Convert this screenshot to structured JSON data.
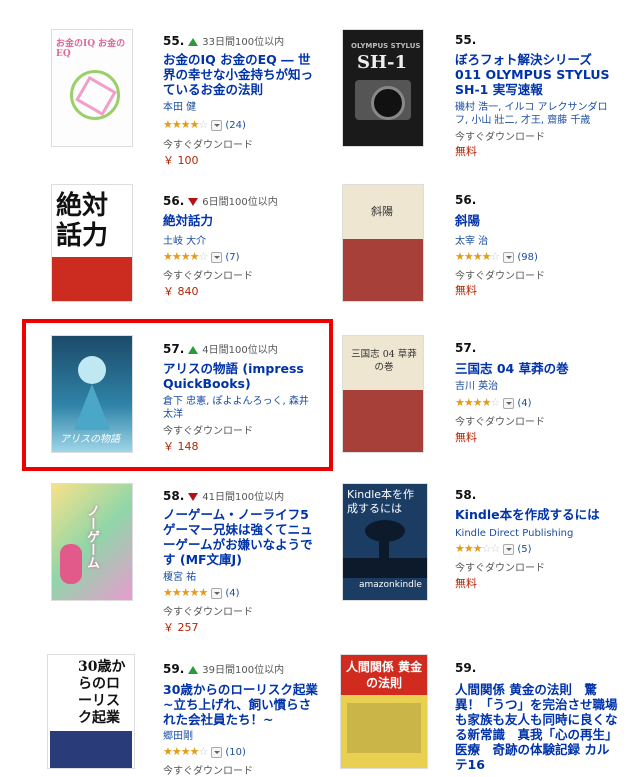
{
  "items": {
    "i55a": {
      "rank": "55.",
      "meta": "33日間100位以内",
      "title": "お金のIQ お金のEQ ― 世界の幸せな小金持ちが知っているお金の法則",
      "author": "本田 健",
      "reviews": "(24)",
      "availability": "今すぐダウンロード",
      "price": "￥ 100",
      "cover_text": "お金のIQ お金のEQ"
    },
    "i55b": {
      "rank": "55.",
      "title": "ぼろフォト解決シリーズ011 OLYMPUS STYLUS SH-1 実写速報",
      "author": "磯村 浩一, イルコ アレクサンダロフ, 小山 壯二, 才王, 齋藤 千歳",
      "availability": "今すぐダウンロード",
      "price": "無料",
      "cover_text": "SH-1"
    },
    "i56a": {
      "rank": "56.",
      "meta": "6日間100位以内",
      "title": "絶対話力",
      "author": "土岐 大介",
      "reviews": "(7)",
      "availability": "今すぐダウンロード",
      "price": "￥ 840",
      "cover_text": "絶対話力"
    },
    "i56b": {
      "rank": "56.",
      "title": "斜陽",
      "author": "太宰 治",
      "reviews": "(98)",
      "availability": "今すぐダウンロード",
      "price": "無料",
      "cover_text": "斜陽"
    },
    "i57a": {
      "rank": "57.",
      "meta": "4日間100位以内",
      "title": "アリスの物語 (impress QuickBooks)",
      "author": "倉下 忠憲, ぽよよんろっく, 森井 太洋",
      "availability": "今すぐダウンロード",
      "price": "￥ 148",
      "cover_text": "アリスの物語"
    },
    "i57b": {
      "rank": "57.",
      "title": "三国志 04 草莽の巻",
      "author": "吉川 英治",
      "reviews": "(4)",
      "availability": "今すぐダウンロード",
      "price": "無料",
      "cover_text": "三国志 04 草莽の巻"
    },
    "i58a": {
      "rank": "58.",
      "meta": "41日間100位以内",
      "title": "ノーゲーム・ノーライフ5 ゲーマー兄妹は強くてニューゲームがお嫌いなようです (MF文庫J)",
      "author": "榎宮 祐",
      "reviews": "(4)",
      "availability": "今すぐダウンロード",
      "price": "￥ 257",
      "cover_text": "ノーゲーム"
    },
    "i58b": {
      "rank": "58.",
      "title": "Kindle本を作成するには",
      "author": "Kindle Direct Publishing",
      "reviews": "(5)",
      "availability": "今すぐダウンロード",
      "price": "無料",
      "cover_text": "Kindle本を作成するには",
      "cover_logo": "amazonkindle"
    },
    "i59a": {
      "rank": "59.",
      "meta": "39日間100位以内",
      "title": "30歳からのローリスク起業 ~立ち上げれ、飼い慣らされた会社員たち！~",
      "author": "郷田剛",
      "reviews": "(10)",
      "availability": "今すぐダウンロード",
      "cover_text": "30歳からのローリスク起業"
    },
    "i59b": {
      "rank": "59.",
      "title": "人間関係 黄金の法則　驚異！「うつ」を完治させ職場も家族も友人も同時に良くなる新常識　真我「心の再生」医療　奇跡の体験記録 カルテ16",
      "cover_text": "人間関係 黄金の法則"
    }
  },
  "colors": {
    "link": "#0033aa",
    "price": "#b12704",
    "star": "#e59b14",
    "up": "#2a9a3a",
    "down": "#b31212",
    "highlight": "#ee0000"
  }
}
